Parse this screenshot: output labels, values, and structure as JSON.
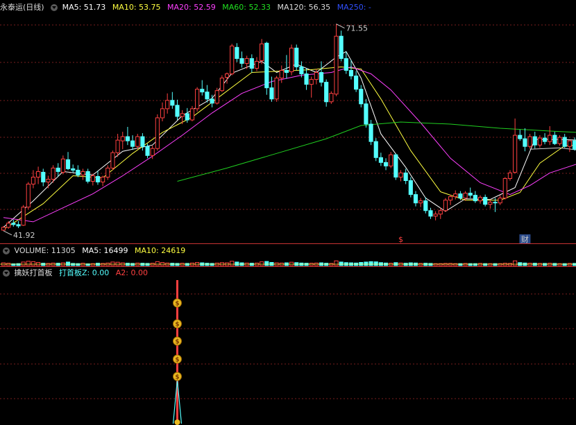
{
  "colors": {
    "up": "#ff4040",
    "down": "#54ffff",
    "ma5": "#ffffff",
    "ma10": "#ffff40",
    "ma20": "#ff40ff",
    "ma60": "#20d020",
    "ma120": "#d8d8d8",
    "ma250": "#2040ff",
    "grid": "#7a1e1e"
  },
  "price_panel": {
    "stock_name": "永泰运(日线)",
    "ma_labels": [
      {
        "text": "MA5: 51.73",
        "key": "ma5"
      },
      {
        "text": "MA10: 53.75",
        "key": "ma10"
      },
      {
        "text": "MA20: 52.59",
        "key": "ma20"
      },
      {
        "text": "MA60: 52.33",
        "key": "ma60"
      },
      {
        "text": "MA120: 56.35",
        "key": "ma120"
      },
      {
        "text": "MA250: -",
        "key": "ma250"
      }
    ],
    "high_label": "71.55",
    "low_label": "41.92",
    "markers": [
      "$",
      "财"
    ]
  },
  "volume_panel": {
    "title": "VOLUME: 11305",
    "ma5": "MA5: 16499",
    "ma10": "MA10: 24619"
  },
  "indicator_panel": {
    "title": "擒妖打首板",
    "series_z": "打首板Z: 0.00",
    "series_a2": "A2: 0.00",
    "icon": "money-bag-icon"
  },
  "chart_data": [
    {
      "type": "candlestick",
      "title": "永泰运(日线)",
      "ylim": [
        41.0,
        73.0
      ],
      "highest": 71.55,
      "lowest": 41.92,
      "candles": [
        [
          42.0,
          42.6,
          41.9,
          42.4
        ],
        [
          42.4,
          43.3,
          42.2,
          43.0
        ],
        [
          43.0,
          43.5,
          42.5,
          42.8
        ],
        [
          42.8,
          43.3,
          42.3,
          42.6
        ],
        [
          42.7,
          45.6,
          42.6,
          45.3
        ],
        [
          45.3,
          48.9,
          45.0,
          48.6
        ],
        [
          48.6,
          50.6,
          48.0,
          49.6
        ],
        [
          49.6,
          51.1,
          48.6,
          50.4
        ],
        [
          50.3,
          50.8,
          48.3,
          48.9
        ],
        [
          48.9,
          49.8,
          48.0,
          49.3
        ],
        [
          49.3,
          51.3,
          48.8,
          50.9
        ],
        [
          50.9,
          51.6,
          49.7,
          50.4
        ],
        [
          50.3,
          52.7,
          50.0,
          52.2
        ],
        [
          52.1,
          53.2,
          50.6,
          50.8
        ],
        [
          50.8,
          51.4,
          50.2,
          50.6
        ],
        [
          50.6,
          51.3,
          49.6,
          49.9
        ],
        [
          49.9,
          50.8,
          49.2,
          50.4
        ],
        [
          50.4,
          50.8,
          48.7,
          49.0
        ],
        [
          49.0,
          50.1,
          48.4,
          49.8
        ],
        [
          49.7,
          50.5,
          48.5,
          48.9
        ],
        [
          48.9,
          49.8,
          48.3,
          49.6
        ],
        [
          49.6,
          51.3,
          49.2,
          50.9
        ],
        [
          50.9,
          53.4,
          50.6,
          53.1
        ],
        [
          53.1,
          55.8,
          52.5,
          54.9
        ],
        [
          54.8,
          56.1,
          53.6,
          55.4
        ],
        [
          55.4,
          56.8,
          54.2,
          54.8
        ],
        [
          54.8,
          55.6,
          53.5,
          54.0
        ],
        [
          54.0,
          55.8,
          53.6,
          55.4
        ],
        [
          55.4,
          55.9,
          53.4,
          54.0
        ],
        [
          54.0,
          54.4,
          52.3,
          52.7
        ],
        [
          52.7,
          54.1,
          52.2,
          53.7
        ],
        [
          53.7,
          58.6,
          53.4,
          58.1
        ],
        [
          58.1,
          60.3,
          57.6,
          59.4
        ],
        [
          59.4,
          61.6,
          58.7,
          60.6
        ],
        [
          60.6,
          61.8,
          59.4,
          59.9
        ],
        [
          59.9,
          60.7,
          57.8,
          58.3
        ],
        [
          58.3,
          59.2,
          57.2,
          58.7
        ],
        [
          58.7,
          59.5,
          57.4,
          57.8
        ],
        [
          57.8,
          59.8,
          57.6,
          59.4
        ],
        [
          59.4,
          62.5,
          59.0,
          62.2
        ],
        [
          62.2,
          63.5,
          61.3,
          61.8
        ],
        [
          61.8,
          62.8,
          60.3,
          60.8
        ],
        [
          60.8,
          61.4,
          59.6,
          60.2
        ],
        [
          60.2,
          62.4,
          60.0,
          62.0
        ],
        [
          62.0,
          64.2,
          61.8,
          63.8
        ],
        [
          63.9,
          64.6,
          63.0,
          64.4
        ],
        [
          64.4,
          68.7,
          64.2,
          68.4
        ],
        [
          68.2,
          68.8,
          66.1,
          66.6
        ],
        [
          66.6,
          67.6,
          65.3,
          65.9
        ],
        [
          65.9,
          67.0,
          65.1,
          66.6
        ],
        [
          66.6,
          67.2,
          64.6,
          65.2
        ],
        [
          65.2,
          66.8,
          64.8,
          66.2
        ],
        [
          66.3,
          69.4,
          65.8,
          68.7
        ],
        [
          68.8,
          69.0,
          61.4,
          62.4
        ],
        [
          62.4,
          64.0,
          60.4,
          60.8
        ],
        [
          60.8,
          64.1,
          60.4,
          63.8
        ],
        [
          63.8,
          65.6,
          63.1,
          64.9
        ],
        [
          64.9,
          67.1,
          63.7,
          64.6
        ],
        [
          64.7,
          68.6,
          64.2,
          68.1
        ],
        [
          68.1,
          68.6,
          64.9,
          65.4
        ],
        [
          65.4,
          66.2,
          63.9,
          64.4
        ],
        [
          64.4,
          65.2,
          62.1,
          62.9
        ],
        [
          62.9,
          64.0,
          61.0,
          63.6
        ],
        [
          63.6,
          65.1,
          62.9,
          64.6
        ],
        [
          64.6,
          66.2,
          62.6,
          63.2
        ],
        [
          63.2,
          63.6,
          59.7,
          60.4
        ],
        [
          60.4,
          61.9,
          60.1,
          61.6
        ],
        [
          61.5,
          71.55,
          61.2,
          69.8
        ],
        [
          69.8,
          70.6,
          66.2,
          66.6
        ],
        [
          66.6,
          67.6,
          64.4,
          64.9
        ],
        [
          64.9,
          66.4,
          63.6,
          64.1
        ],
        [
          64.1,
          64.8,
          61.8,
          62.2
        ],
        [
          62.2,
          62.8,
          59.6,
          60.1
        ],
        [
          60.1,
          60.8,
          56.7,
          57.2
        ],
        [
          57.2,
          57.8,
          54.2,
          54.7
        ],
        [
          54.7,
          55.2,
          51.9,
          52.4
        ],
        [
          52.4,
          53.1,
          51.2,
          51.7
        ],
        [
          51.7,
          52.3,
          50.6,
          51.2
        ],
        [
          51.2,
          53.2,
          50.9,
          52.8
        ],
        [
          52.8,
          53.0,
          49.2,
          49.6
        ],
        [
          49.6,
          50.6,
          49.0,
          50.2
        ],
        [
          50.2,
          50.8,
          48.6,
          49.1
        ],
        [
          49.1,
          49.6,
          46.7,
          47.1
        ],
        [
          47.1,
          47.6,
          45.4,
          45.9
        ],
        [
          45.9,
          46.6,
          45.3,
          46.2
        ],
        [
          46.2,
          46.7,
          44.4,
          44.8
        ],
        [
          44.8,
          45.2,
          43.6,
          44.0
        ],
        [
          44.0,
          44.7,
          43.4,
          44.3
        ],
        [
          44.3,
          45.2,
          43.6,
          44.8
        ],
        [
          44.8,
          46.6,
          44.6,
          46.3
        ],
        [
          46.3,
          47.1,
          45.6,
          46.8
        ],
        [
          46.8,
          47.7,
          46.4,
          47.2
        ],
        [
          47.2,
          47.6,
          46.3,
          46.6
        ],
        [
          46.6,
          47.6,
          46.2,
          47.3
        ],
        [
          47.3,
          48.1,
          46.6,
          47.0
        ],
        [
          47.0,
          47.6,
          45.9,
          46.2
        ],
        [
          46.2,
          47.0,
          45.8,
          46.7
        ],
        [
          46.7,
          47.1,
          45.4,
          45.7
        ],
        [
          45.7,
          46.4,
          45.1,
          46.0
        ],
        [
          46.0,
          46.6,
          44.6,
          45.9
        ],
        [
          45.9,
          47.0,
          45.6,
          46.6
        ],
        [
          46.6,
          49.6,
          46.4,
          49.4
        ],
        [
          49.4,
          50.6,
          49.1,
          50.2
        ],
        [
          50.3,
          58.0,
          50.1,
          55.6
        ],
        [
          55.6,
          56.4,
          54.8,
          55.1
        ],
        [
          55.1,
          56.6,
          53.3,
          54.0
        ],
        [
          54.0,
          55.8,
          53.7,
          55.4
        ],
        [
          55.4,
          56.1,
          53.7,
          54.2
        ],
        [
          54.2,
          55.6,
          53.8,
          55.2
        ],
        [
          55.2,
          55.9,
          54.3,
          54.7
        ],
        [
          54.7,
          56.9,
          54.2,
          55.6
        ],
        [
          55.6,
          56.1,
          54.2,
          54.4
        ],
        [
          54.4,
          55.6,
          54.1,
          55.3
        ],
        [
          55.3,
          55.8,
          53.8,
          54.0
        ],
        [
          54.0,
          54.6,
          53.2,
          54.8
        ],
        [
          54.8,
          55.3,
          53.4,
          53.6
        ]
      ],
      "ma": {
        "MA5": [
          [
            0,
            42.4
          ],
          [
            6,
            46.2
          ],
          [
            12,
            50.4
          ],
          [
            18,
            49.9
          ],
          [
            24,
            53.3
          ],
          [
            30,
            54.2
          ],
          [
            36,
            58.4
          ],
          [
            42,
            60.9
          ],
          [
            46,
            64.5
          ],
          [
            52,
            66.2
          ],
          [
            55,
            64.6
          ],
          [
            59,
            65.8
          ],
          [
            63,
            64.6
          ],
          [
            67,
            66.8
          ],
          [
            69,
            67.6
          ],
          [
            72,
            63.8
          ],
          [
            76,
            55.8
          ],
          [
            81,
            51.0
          ],
          [
            85,
            46.6
          ],
          [
            89,
            44.7
          ],
          [
            93,
            46.5
          ],
          [
            98,
            46.4
          ],
          [
            103,
            48.1
          ],
          [
            107,
            55.0
          ],
          [
            112,
            55.0
          ],
          [
            119,
            54.8
          ]
        ],
        "MA10": [
          [
            0,
            42.1
          ],
          [
            8,
            45.8
          ],
          [
            14,
            49.8
          ],
          [
            20,
            49.5
          ],
          [
            26,
            53.0
          ],
          [
            32,
            56.0
          ],
          [
            38,
            58.2
          ],
          [
            44,
            61.4
          ],
          [
            50,
            64.6
          ],
          [
            56,
            64.8
          ],
          [
            62,
            65.0
          ],
          [
            68,
            65.4
          ],
          [
            72,
            65.1
          ],
          [
            76,
            60.8
          ],
          [
            82,
            53.4
          ],
          [
            88,
            47.5
          ],
          [
            93,
            46.3
          ],
          [
            100,
            46.3
          ],
          [
            104,
            47.4
          ],
          [
            108,
            51.6
          ],
          [
            113,
            54.1
          ],
          [
            119,
            54.3
          ]
        ],
        "MA20": [
          [
            0,
            43.8
          ],
          [
            6,
            43.2
          ],
          [
            12,
            45.2
          ],
          [
            18,
            47.2
          ],
          [
            24,
            49.8
          ],
          [
            30,
            52.6
          ],
          [
            36,
            55.6
          ],
          [
            42,
            58.8
          ],
          [
            48,
            61.6
          ],
          [
            54,
            63.3
          ],
          [
            60,
            64.2
          ],
          [
            66,
            64.6
          ],
          [
            70,
            65.4
          ],
          [
            74,
            64.4
          ],
          [
            78,
            62.1
          ],
          [
            84,
            57.4
          ],
          [
            90,
            52.3
          ],
          [
            96,
            48.8
          ],
          [
            102,
            47.1
          ],
          [
            106,
            48.4
          ],
          [
            110,
            50.2
          ],
          [
            116,
            51.6
          ],
          [
            119,
            52.6
          ]
        ],
        "MA60": [
          [
            35,
            49.0
          ],
          [
            45,
            50.9
          ],
          [
            55,
            53.0
          ],
          [
            65,
            55.1
          ],
          [
            72,
            57.0
          ],
          [
            80,
            57.5
          ],
          [
            90,
            57.2
          ],
          [
            100,
            56.6
          ],
          [
            110,
            56.2
          ],
          [
            119,
            55.9
          ]
        ],
        "MA120": [
          [
            106,
            53.6
          ],
          [
            112,
            53.8
          ],
          [
            119,
            53.2
          ]
        ]
      },
      "markers": [
        {
          "index": 80,
          "label": "$"
        },
        {
          "index": 105,
          "label": "财"
        }
      ]
    },
    {
      "type": "bar",
      "title": "VOLUME: 11305",
      "values": [
        14,
        12,
        9,
        10,
        18,
        22,
        20,
        16,
        12,
        11,
        13,
        12,
        14,
        18,
        11,
        10,
        12,
        9,
        10,
        12,
        11,
        13,
        18,
        17,
        14,
        12,
        11,
        13,
        12,
        11,
        12,
        20,
        16,
        13,
        12,
        11,
        12,
        11,
        13,
        16,
        14,
        12,
        11,
        13,
        15,
        14,
        22,
        18,
        14,
        13,
        12,
        13,
        19,
        21,
        16,
        14,
        13,
        14,
        17,
        15,
        13,
        12,
        12,
        13,
        14,
        12,
        11,
        24,
        18,
        15,
        14,
        13,
        16,
        18,
        20,
        19,
        15,
        13,
        12,
        15,
        13,
        12,
        14,
        13,
        11,
        12,
        11,
        10,
        10,
        11,
        11,
        10,
        10,
        11,
        10,
        10,
        11,
        10,
        10,
        10,
        10,
        12,
        11,
        24,
        15,
        13,
        12,
        12,
        11,
        11,
        12,
        11,
        10,
        10,
        11,
        11
      ]
    },
    {
      "type": "line",
      "title": "擒妖打首板",
      "series": [
        {
          "name": "打首板Z",
          "spike_index": 35
        },
        {
          "name": "A2",
          "spike_index": 35
        }
      ]
    }
  ]
}
